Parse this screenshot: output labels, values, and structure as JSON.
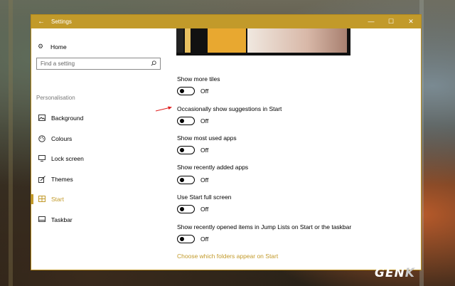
{
  "window": {
    "title": "Settings",
    "back_glyph": "←",
    "controls": {
      "minimize": "—",
      "maximize": "☐",
      "close": "✕"
    },
    "accent": "#c29a2a"
  },
  "sidebar": {
    "home": "Home",
    "search_placeholder": "Find a setting",
    "section": "Personalisation",
    "items": [
      {
        "label": "Background",
        "icon": "picture-icon"
      },
      {
        "label": "Colours",
        "icon": "palette-icon"
      },
      {
        "label": "Lock screen",
        "icon": "monitor-icon"
      },
      {
        "label": "Themes",
        "icon": "brush-icon"
      },
      {
        "label": "Start",
        "icon": "start-grid-icon",
        "active": true
      },
      {
        "label": "Taskbar",
        "icon": "taskbar-icon"
      }
    ]
  },
  "content": {
    "settings": [
      {
        "label": "Show more tiles",
        "state": "Off"
      },
      {
        "label": "Occasionally show suggestions in Start",
        "state": "Off"
      },
      {
        "label": "Show most used apps",
        "state": "Off"
      },
      {
        "label": "Show recently added apps",
        "state": "Off"
      },
      {
        "label": "Use Start full screen",
        "state": "Off"
      },
      {
        "label": "Show recently opened items in Jump Lists on Start or the taskbar",
        "state": "Off"
      }
    ],
    "link": "Choose which folders appear on Start"
  },
  "watermark": {
    "main": "GEN",
    "tail": "K"
  }
}
